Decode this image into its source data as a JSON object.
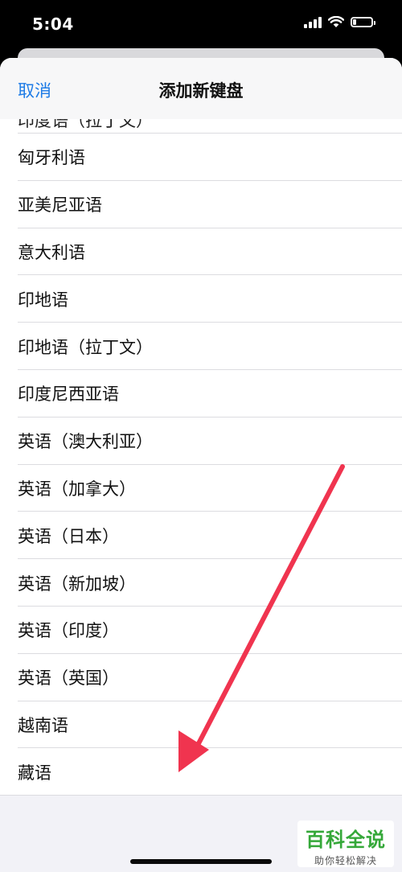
{
  "status_bar": {
    "time": "5:04",
    "battery_level": 0.2
  },
  "nav": {
    "cancel_label": "取消",
    "title": "添加新键盘"
  },
  "languages": [
    "匈牙利语",
    "亚美尼亚语",
    "意大利语",
    "印地语",
    "印地语（拉丁文）",
    "印度尼西亚语",
    "英语（澳大利亚）",
    "英语（加拿大）",
    "英语（日本）",
    "英语（新加坡）",
    "英语（印度）",
    "英语（英国）",
    "越南语",
    "藏语"
  ],
  "watermark": {
    "main": "百科全说",
    "sub": "助你轻松解决"
  },
  "colors": {
    "accent": "#1e7be6",
    "arrow": "#f0344f",
    "watermark_green": "#35a839"
  }
}
